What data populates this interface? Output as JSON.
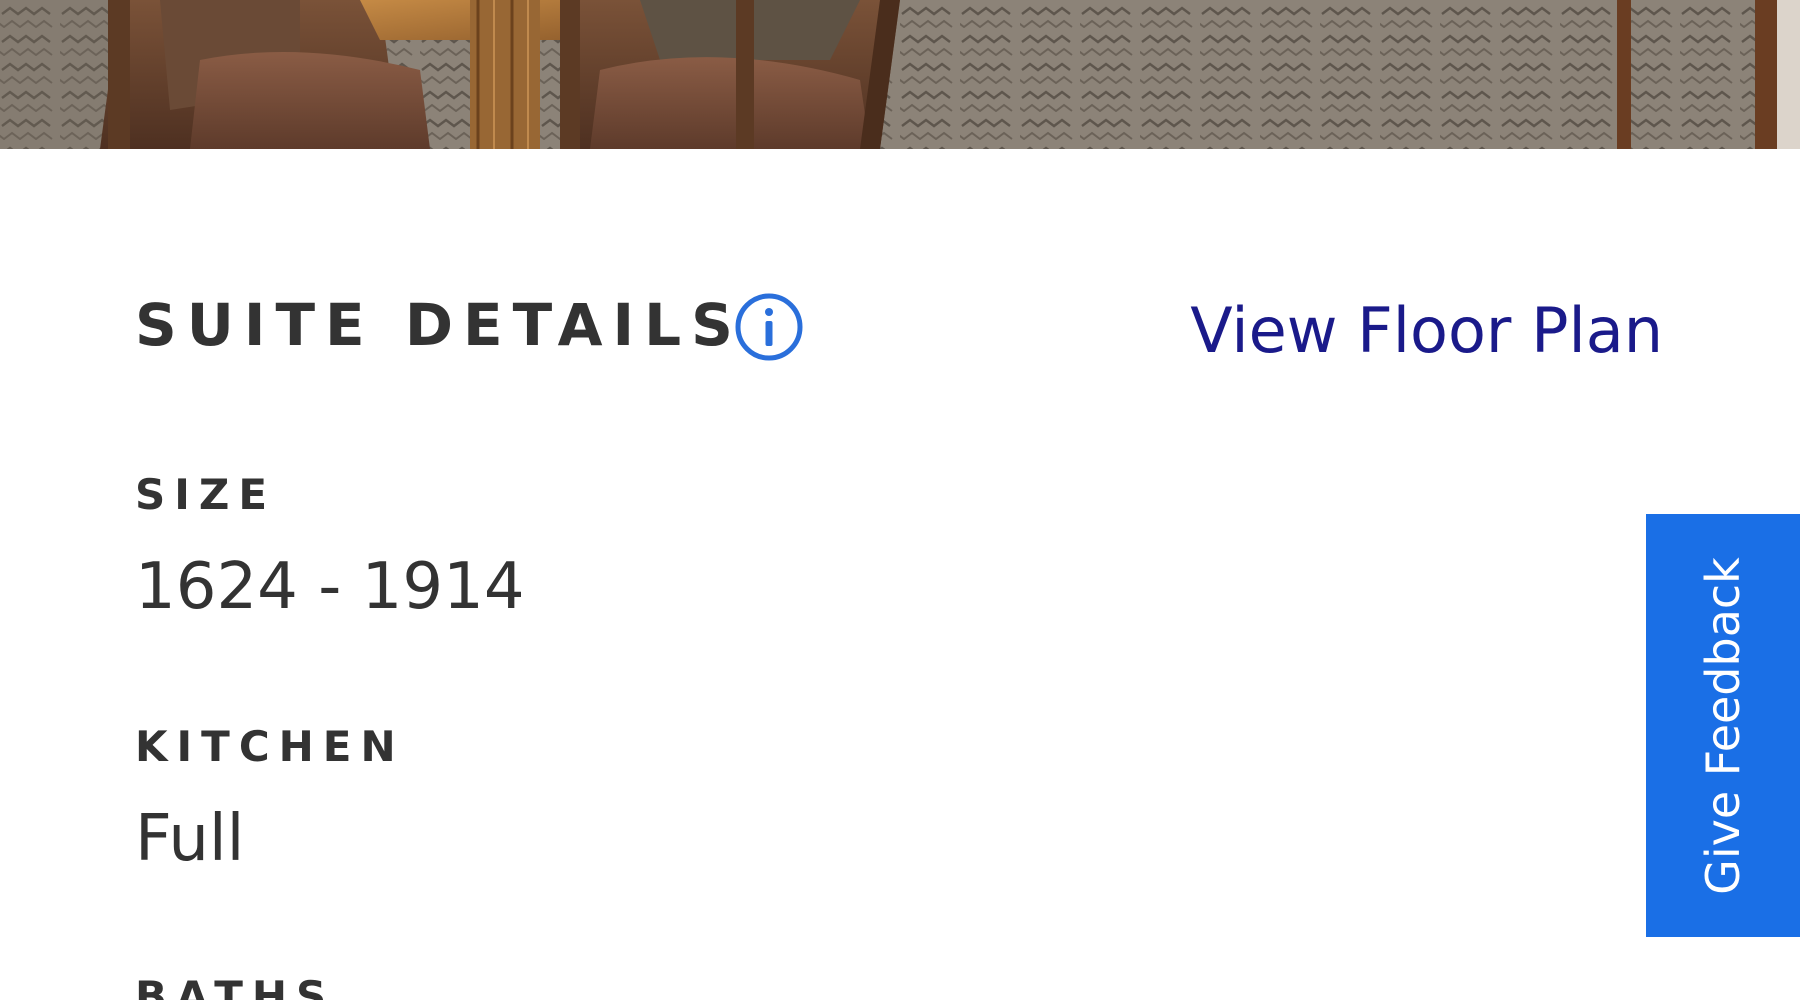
{
  "hero": {
    "image": "dining-room-photo"
  },
  "suite_details": {
    "title": "SUITE DETAILS",
    "info_icon": "info-circle-icon",
    "floor_plan_link": "View Floor Plan",
    "size": {
      "label": "SIZE",
      "value": "1624 - 1914"
    },
    "kitchen": {
      "label": "KITCHEN",
      "value": "Full"
    },
    "baths": {
      "label": "BATHS"
    }
  },
  "feedback": {
    "label": "Give Feedback"
  },
  "colors": {
    "heading_text": "#333333",
    "link": "#1a1a8a",
    "info_icon": "#2a6fdb",
    "feedback_bg": "#1a6fe6"
  }
}
